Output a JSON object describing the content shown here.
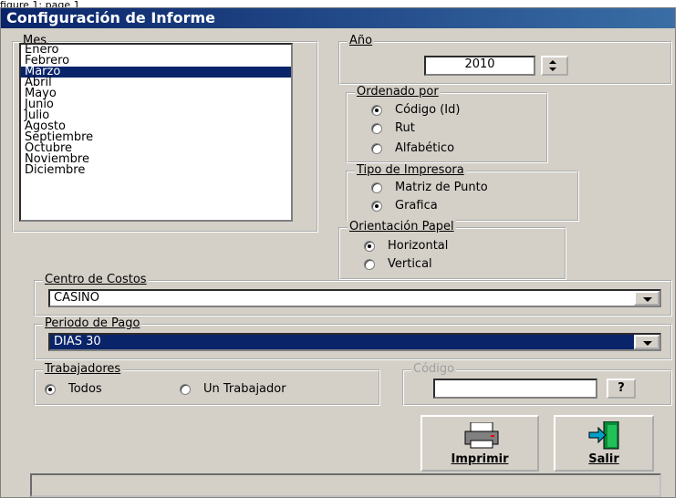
{
  "caption": "figure 1: page 1",
  "window": {
    "title": "Configuración de Informe"
  },
  "mes": {
    "label": "Mes",
    "items": [
      "Enero",
      "Febrero",
      "Marzo",
      "Abril",
      "Mayo",
      "Junio",
      "Julio",
      "Agosto",
      "Septiembre",
      "Octubre",
      "Noviembre",
      "Diciembre"
    ],
    "selected": "Marzo"
  },
  "anio": {
    "label": "Año",
    "value": "2010"
  },
  "ordenado": {
    "label": "Ordenado por",
    "options": [
      "Código (Id)",
      "Rut",
      "Alfabético"
    ],
    "selected": "Código (Id)"
  },
  "impresora": {
    "label": "Tipo de Impresora",
    "options": [
      "Matriz de Punto",
      "Grafica"
    ],
    "selected": "Grafica"
  },
  "orientacion": {
    "label": "Orientación Papel",
    "options": [
      "Horizontal",
      "Vertical"
    ],
    "selected": "Horizontal"
  },
  "centro": {
    "label": "Centro de Costos",
    "value": "CASINO"
  },
  "periodo": {
    "label": "Periodo de Pago",
    "value": "DIAS 30"
  },
  "trabajadores": {
    "label": "Trabajadores",
    "options": [
      "Todos",
      "Un Trabajador"
    ],
    "selected": "Todos"
  },
  "codigo": {
    "label": "Código",
    "value": "",
    "button": "?"
  },
  "buttons": {
    "imprimir": "Imprimir",
    "salir": "Salir"
  },
  "colors": {
    "titlebar_start": "#0a246a",
    "titlebar_end": "#3a6ea5",
    "dialog_bg": "#d4d0c8",
    "selection": "#0a246a"
  }
}
